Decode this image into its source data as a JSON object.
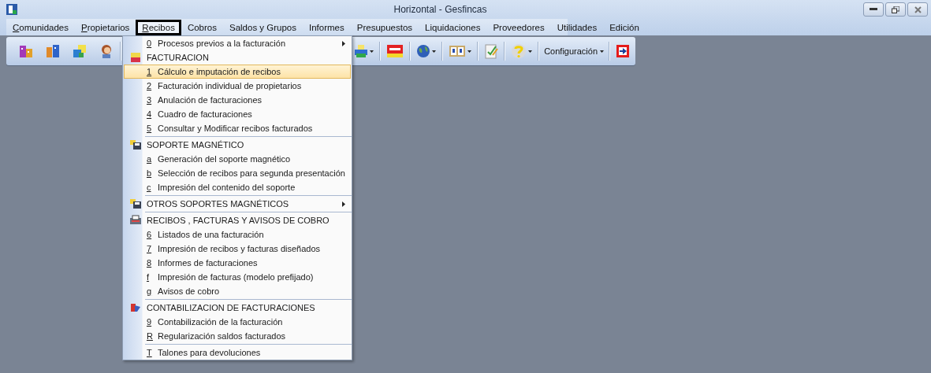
{
  "window": {
    "title": "Horizontal - Gesfincas"
  },
  "menu_bar": [
    {
      "key": "C",
      "rest": "omunidades",
      "selected": false
    },
    {
      "key": "P",
      "rest": "ropietarios",
      "selected": false
    },
    {
      "key": "R",
      "rest": "ecibos",
      "selected": true
    },
    {
      "rest": "Cobros",
      "selected": false
    },
    {
      "rest": "Saldos y Grupos",
      "selected": false
    },
    {
      "rest": "Informes",
      "selected": false
    },
    {
      "rest": "Presupuestos",
      "selected": false
    },
    {
      "rest": "Liquidaciones",
      "selected": false
    },
    {
      "rest": "Proveedores",
      "selected": false
    },
    {
      "rest": "Utilidades",
      "selected": false
    },
    {
      "rest": "Edición",
      "selected": false
    }
  ],
  "toolbar_right": [
    {
      "kind": "printer",
      "dropdown": true
    },
    {
      "kind": "ext",
      "dropdown": false
    },
    {
      "kind": "globe",
      "dropdown": true
    },
    {
      "kind": "pages",
      "dropdown": true
    },
    {
      "kind": "notepad",
      "dropdown": false
    },
    {
      "kind": "help",
      "dropdown": true
    },
    {
      "kind": "text",
      "label": "Configuración",
      "dropdown": true
    },
    {
      "kind": "exit",
      "dropdown": false
    }
  ],
  "dropdown": [
    {
      "kind": "item",
      "key": "0",
      "label": "Procesos previos a la facturación",
      "submenu": true,
      "selected": false
    },
    {
      "kind": "header",
      "label": "FACTURACION",
      "submenu": false
    },
    {
      "kind": "item",
      "key": "1",
      "label": "Cálculo e imputación de recibos",
      "submenu": false,
      "selected": true
    },
    {
      "kind": "item",
      "key": "2",
      "label": "Facturación individual de propietarios",
      "submenu": false,
      "selected": false
    },
    {
      "kind": "item",
      "key": "3",
      "label": "Anulación de facturaciones",
      "submenu": false,
      "selected": false
    },
    {
      "kind": "item",
      "key": "4",
      "label": "Cuadro de facturaciones",
      "submenu": false,
      "selected": false
    },
    {
      "kind": "item",
      "key": "5",
      "label": "Consultar y Modificar recibos facturados",
      "submenu": false,
      "selected": false
    },
    {
      "kind": "separator"
    },
    {
      "kind": "header",
      "label": "SOPORTE MAGNÉTICO",
      "submenu": false
    },
    {
      "kind": "item",
      "key": "a",
      "label": "Generación del soporte magnético",
      "submenu": false,
      "selected": false
    },
    {
      "kind": "item",
      "key": "b",
      "label": "Selección de recibos para segunda presentación",
      "submenu": false,
      "selected": false
    },
    {
      "kind": "item",
      "key": "c",
      "label": "Impresión del contenido del soporte",
      "submenu": false,
      "selected": false
    },
    {
      "kind": "separator"
    },
    {
      "kind": "header",
      "label": "OTROS SOPORTES MAGNÉTICOS",
      "submenu": true
    },
    {
      "kind": "separator"
    },
    {
      "kind": "header",
      "label": "RECIBOS , FACTURAS Y AVISOS DE COBRO",
      "submenu": false
    },
    {
      "kind": "item",
      "key": "6",
      "label": "Listados de una facturación",
      "submenu": false,
      "selected": false
    },
    {
      "kind": "item",
      "key": "7",
      "label": "Impresión de recibos y facturas diseñados",
      "submenu": false,
      "selected": false
    },
    {
      "kind": "item",
      "key": "8",
      "label": "Informes de facturaciones",
      "submenu": false,
      "selected": false
    },
    {
      "kind": "item",
      "key": "f",
      "label": "Impresión de facturas (modelo prefijado)",
      "submenu": false,
      "selected": false
    },
    {
      "kind": "item",
      "key": "g",
      "label": "Avisos de cobro",
      "submenu": false,
      "selected": false
    },
    {
      "kind": "separator"
    },
    {
      "kind": "header",
      "label": "CONTABILIZACION DE FACTURACIONES",
      "submenu": false
    },
    {
      "kind": "item",
      "key": "9",
      "label": "Contabilización de la facturación",
      "submenu": false,
      "selected": false
    },
    {
      "kind": "item",
      "key": "R",
      "label": "Regularización saldos facturados",
      "submenu": false,
      "selected": false
    },
    {
      "kind": "separator"
    },
    {
      "kind": "item",
      "key": "T",
      "label": "Talones para devoluciones",
      "submenu": false,
      "selected": false
    }
  ]
}
